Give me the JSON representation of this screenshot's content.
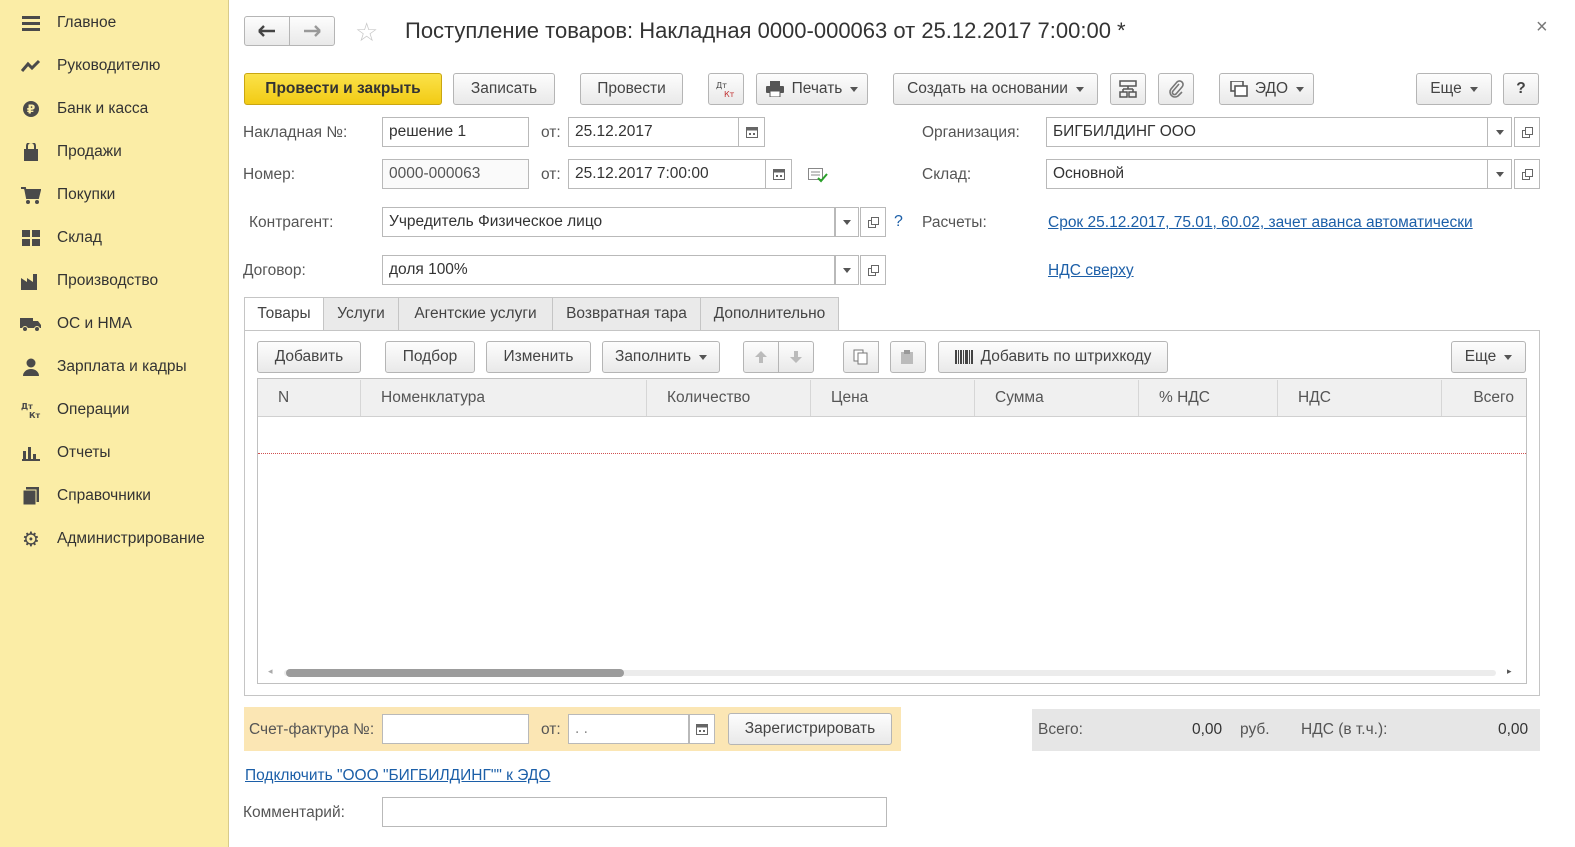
{
  "sidebar": {
    "items": [
      {
        "label": "Главное",
        "icon": "menu-icon"
      },
      {
        "label": "Руководителю",
        "icon": "trend-icon"
      },
      {
        "label": "Банк и касса",
        "icon": "ruble-icon"
      },
      {
        "label": "Продажи",
        "icon": "bag-icon"
      },
      {
        "label": "Покупки",
        "icon": "cart-icon"
      },
      {
        "label": "Склад",
        "icon": "warehouse-icon"
      },
      {
        "label": "Производство",
        "icon": "factory-icon"
      },
      {
        "label": "ОС и НМА",
        "icon": "truck-icon"
      },
      {
        "label": "Зарплата и кадры",
        "icon": "person-icon"
      },
      {
        "label": "Операции",
        "icon": "dt-kt-icon"
      },
      {
        "label": "Отчеты",
        "icon": "bar-chart-icon"
      },
      {
        "label": "Справочники",
        "icon": "books-icon"
      },
      {
        "label": "Администрирование",
        "icon": "gear-icon"
      }
    ]
  },
  "header": {
    "title": "Поступление товаров: Накладная 0000-000063 от 25.12.2017 7:00:00 *",
    "close": "×"
  },
  "toolbar": {
    "post_close": "Провести и закрыть",
    "save": "Записать",
    "post": "Провести",
    "dtkt": "Дт Кт",
    "print": "Печать",
    "create_based": "Создать на основании",
    "edo": "ЭДО",
    "more": "Еще",
    "help": "?"
  },
  "form": {
    "invoice_label": "Накладная  №:",
    "invoice_value": "решение 1",
    "from_label": "от:",
    "invoice_date": "25.12.2017",
    "number_label": "Номер:",
    "number_value": "0000-000063",
    "number_date": "25.12.2017  7:00:00",
    "org_label": "Организация:",
    "org_value": "БИГБИЛДИНГ ООО",
    "warehouse_label": "Склад:",
    "warehouse_value": "Основной",
    "counterparty_label": "Контрагент:",
    "counterparty_value": "Учредитель Физическое лицо",
    "question": "?",
    "settlements_label": "Расчеты:",
    "settlements_link": "Срок 25.12.2017, 75.01, 60.02, зачет аванса автоматически",
    "contract_label": "Договор:",
    "contract_value": "доля 100%",
    "vat_link": "НДС сверху"
  },
  "tabs": [
    "Товары",
    "Услуги",
    "Агентские услуги",
    "Возвратная тара",
    "Дополнительно"
  ],
  "table_toolbar": {
    "add": "Добавить",
    "pick": "Подбор",
    "edit": "Изменить",
    "fill": "Заполнить",
    "barcode": "Добавить по штрихкоду",
    "more": "Еще"
  },
  "table": {
    "columns": [
      "N",
      "Номенклатура",
      "Количество",
      "Цена",
      "Сумма",
      "% НДС",
      "НДС",
      "Всего"
    ]
  },
  "footer": {
    "invoice_label": "Счет-фактура №:",
    "from_label": "от:",
    "date_placeholder": " .  .",
    "register": "Зарегистрировать",
    "total_label": "Всего:",
    "total_value": "0,00",
    "currency": "руб.",
    "vat_label": "НДС (в т.ч.):",
    "vat_value": "0,00",
    "edo_link": "Подключить \"ООО \"БИГБИЛДИНГ\"\" к ЭДО",
    "comment_label": "Комментарий:"
  },
  "colors": {
    "sidebar_bg": "#fbeda6",
    "primary_button": "#f2cb14",
    "link": "#1c5fa8",
    "invoice_panel": "#fbe6b4",
    "totals_panel": "#e6e6e6"
  }
}
